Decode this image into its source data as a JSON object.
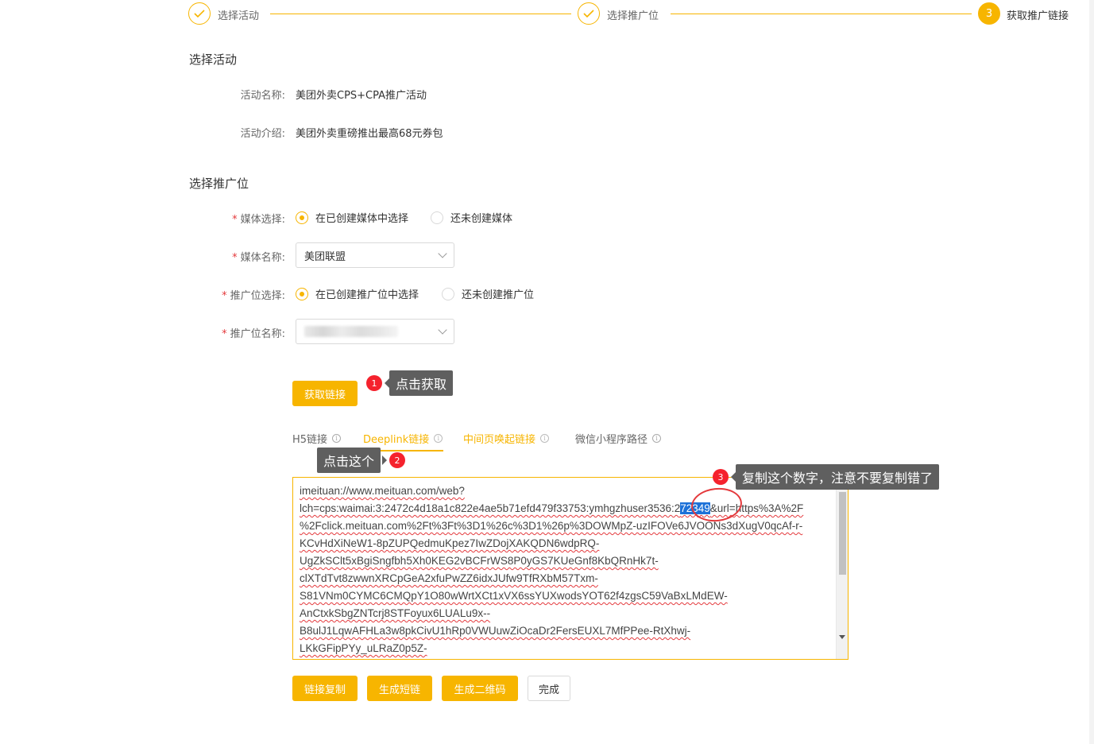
{
  "steps": [
    {
      "label": "选择活动",
      "state": "done"
    },
    {
      "label": "选择推广位",
      "state": "done"
    },
    {
      "label": "获取推广链接",
      "state": "active",
      "number": "3"
    }
  ],
  "activity": {
    "section_title": "选择活动",
    "name_label": "活动名称:",
    "name_value": "美团外卖CPS+CPA推广活动",
    "intro_label": "活动介绍:",
    "intro_value": "美团外卖重磅推出最高68元券包"
  },
  "position": {
    "section_title": "选择推广位",
    "media_choice_label": "媒体选择:",
    "media_choice_options": [
      "在已创建媒体中选择",
      "还未创建媒体"
    ],
    "media_name_label": "媒体名称:",
    "media_name_value": "美团联盟",
    "position_choice_label": "推广位选择:",
    "position_choice_options": [
      "在已创建推广位中选择",
      "还未创建推广位"
    ],
    "position_name_label": "推广位名称:"
  },
  "get_link_button": "获取链接",
  "tabs": [
    {
      "label": "H5链接"
    },
    {
      "label": "Deeplink链接",
      "active": true
    },
    {
      "label": "中间页唤起链接"
    },
    {
      "label": "微信小程序路径"
    }
  ],
  "link_text": {
    "line1": "imeituan://www.meituan.com/web?",
    "line2_before": "lch=cps:waimai:3:2472c4d18a1c822e4ae5b71efd479f33753:ymhgzhuser3536:2",
    "line2_selected": "72349",
    "line2_after": "&url=https%3A%2F",
    "line3": "%2Fclick.meituan.com%2Ft%3Ft%3D1%26c%3D1%26p%3DOWMpZ-uzIFOVe6JVOONs3dXugV0qcAf-r-",
    "line4": "KCvHdXiNeW1-8pZUPQedmuKpez7IwZDojXAKQDN6wdpRQ-",
    "line5": "UgZkSClt5xBgiSngfbh5Xh0KEG2vBCFrWS8P0yGS7KUeGnf8KbQRnHk7t-",
    "line6": "clXTdTvt8zwwnXRCpGeA2xfuPwZZ6idxJUfw9TfRXbM57Txm-",
    "line7": "S81VNm0CYMC6CMQpY1O80wWrtXCt1xVX6ssYUXwodsYOT62f4zgsC59VaBxLMdEW-",
    "line8": "AnCtxkSbgZNTcrj8STFoyux6LUALu9x--",
    "line9": "B8ulJ1LqwAFHLa3w8pkCivU1hRp0VWUuwZiOcaDr2FersEUXL7MfPPee-RtXhwj-",
    "line10": "LKkGFipPYy_uLRaZ0p5Z-"
  },
  "actions": {
    "copy": "链接复制",
    "short": "生成短链",
    "qr": "生成二维码",
    "done": "完成"
  },
  "annotations": [
    {
      "number": "1",
      "text": "点击获取"
    },
    {
      "number": "2",
      "text": "点击这个"
    },
    {
      "number": "3",
      "text": "复制这个数字，注意不要复制错了"
    }
  ],
  "colors": {
    "accent": "#f7b500",
    "annotation_red": "#f5222d",
    "selection": "#1e72d8"
  },
  "icons": {
    "check": "check-icon",
    "chevron": "chevron-down-icon",
    "info": "info-icon"
  }
}
